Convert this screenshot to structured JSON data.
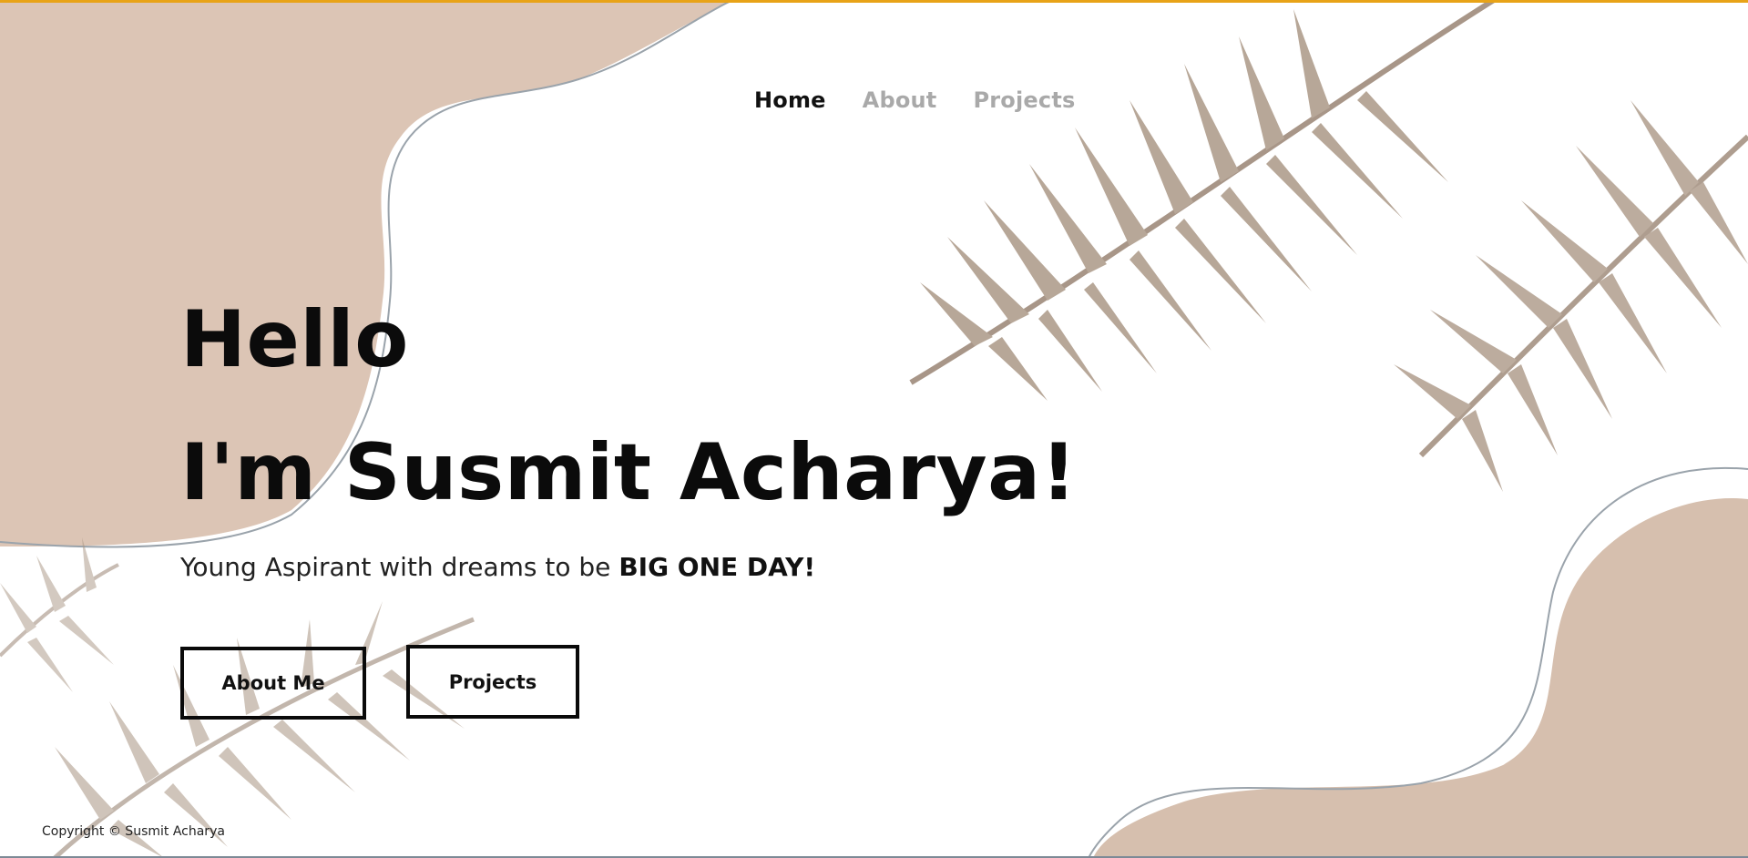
{
  "nav": {
    "items": [
      {
        "label": "Home",
        "active": true
      },
      {
        "label": "About",
        "active": false
      },
      {
        "label": "Projects",
        "active": false
      }
    ]
  },
  "hero": {
    "line1": "Hello",
    "line2": "I'm Susmit Acharya!",
    "tagline_prefix": "Young Aspirant with dreams to be ",
    "tagline_emphasis": "BIG ONE DAY!"
  },
  "buttons": {
    "about_label": "About Me",
    "projects_label": "Projects"
  },
  "footer": {
    "copyright": "Copyright © Susmit Acharya"
  },
  "colors": {
    "accent_top": "#e8a317",
    "blob": "#dcc5b5",
    "leaf": "#9c8571",
    "nav_inactive": "#a9a9a9",
    "text": "#0b0b0b"
  },
  "icons": {
    "background_decoration": "palm-leaf-illustration"
  }
}
